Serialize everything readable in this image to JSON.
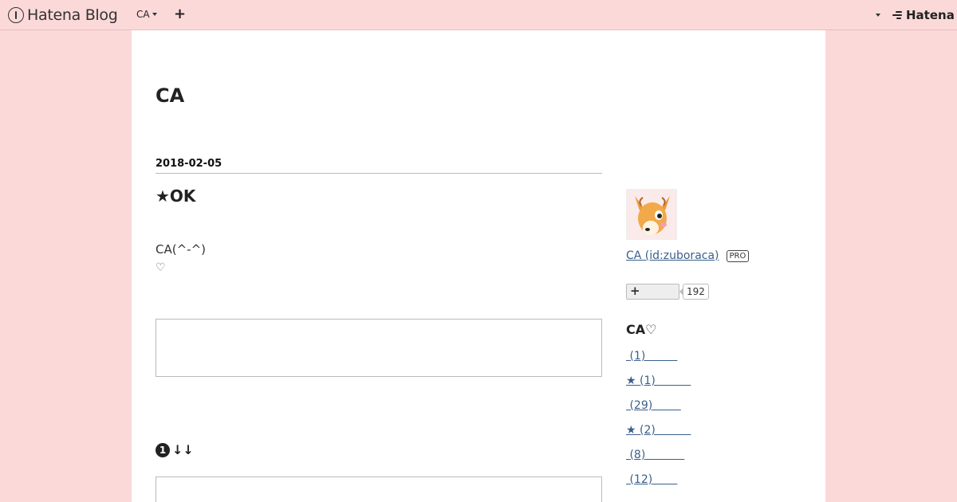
{
  "topbar": {
    "logo_text": "Hatena Blog",
    "blog_switch_label": "CA",
    "add_label": "+",
    "brand_text": "Hatena"
  },
  "blog": {
    "title": "CA"
  },
  "entry": {
    "date": "2018-02-05",
    "title": "★OK",
    "body_line": "CA(^-^)",
    "heart": "♡",
    "section_number": "1",
    "section_arrows": "↓↓"
  },
  "sidebar": {
    "profile_name": "CA (id:zuboraca)",
    "pro_badge": "PRO",
    "follow_label": "+",
    "follow_count": "192",
    "category_heading": "CA♡",
    "categories": [
      {
        "label": " (1)         "
      },
      {
        "label": "★ (1)          "
      },
      {
        "label": " (29)        "
      },
      {
        "label": "★ (2)          "
      },
      {
        "label": " (8)           "
      },
      {
        "label": " (12)       "
      }
    ]
  }
}
